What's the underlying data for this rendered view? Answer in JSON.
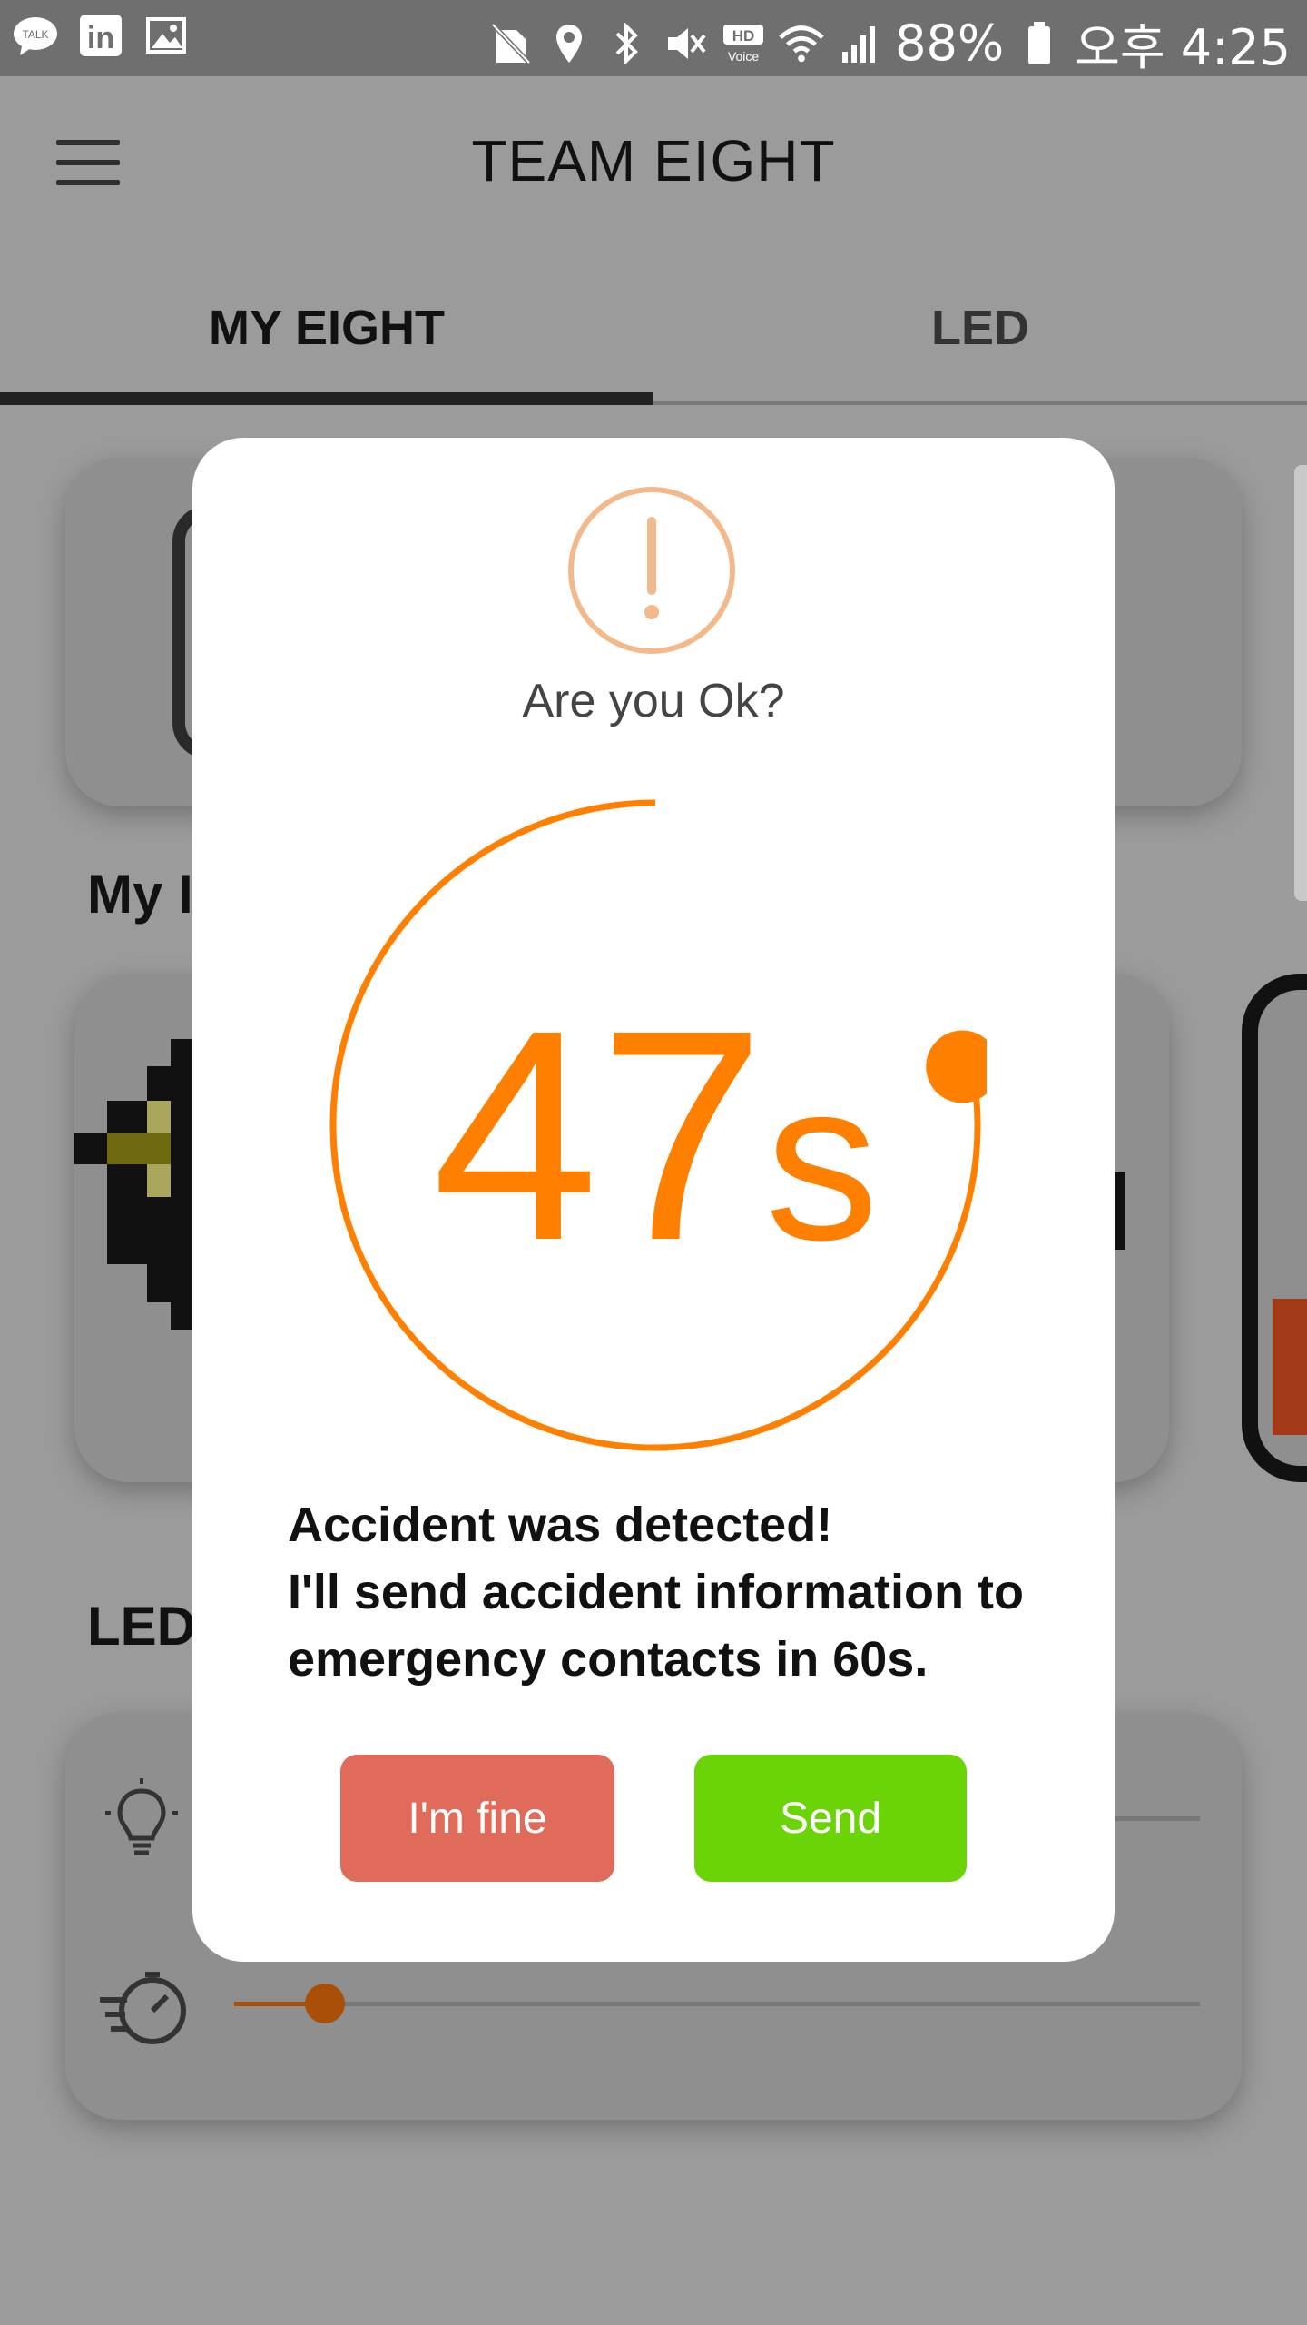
{
  "status_bar": {
    "left_icons": [
      "talk-icon",
      "linkedin-icon",
      "gallery-icon"
    ],
    "talk_text": "TALK",
    "linkedin_text": "in",
    "right_icons": [
      "no-sim-icon",
      "location-icon",
      "bluetooth-icon",
      "mute-icon",
      "hd-voice-icon",
      "wifi-icon",
      "signal-icon",
      "battery-icon"
    ],
    "hd_voice_label": "HD\nVoice",
    "battery": "88%",
    "time": "오후 4:25"
  },
  "app_bar": {
    "title": "TEAM EIGHT"
  },
  "tabs": [
    {
      "label": "MY EIGHT",
      "selected": true
    },
    {
      "label": "LED",
      "selected": false
    }
  ],
  "background": {
    "section_my": "My I",
    "section_led": "LED"
  },
  "dialog": {
    "question": "Are you Ok?",
    "countdown_number": "47",
    "countdown_unit": "s",
    "countdown_progress": 0.78,
    "message_lines": [
      "Accident was detected!",
      "I'll send accident information to",
      "emergency contacts in 60s."
    ],
    "fine_button": "I'm fine",
    "send_button": "Send"
  },
  "colors": {
    "accent_orange": "#ff8000",
    "alert_icon": "#f4b98a",
    "fine_button": "#e06b5b",
    "send_button": "#6bd406"
  }
}
